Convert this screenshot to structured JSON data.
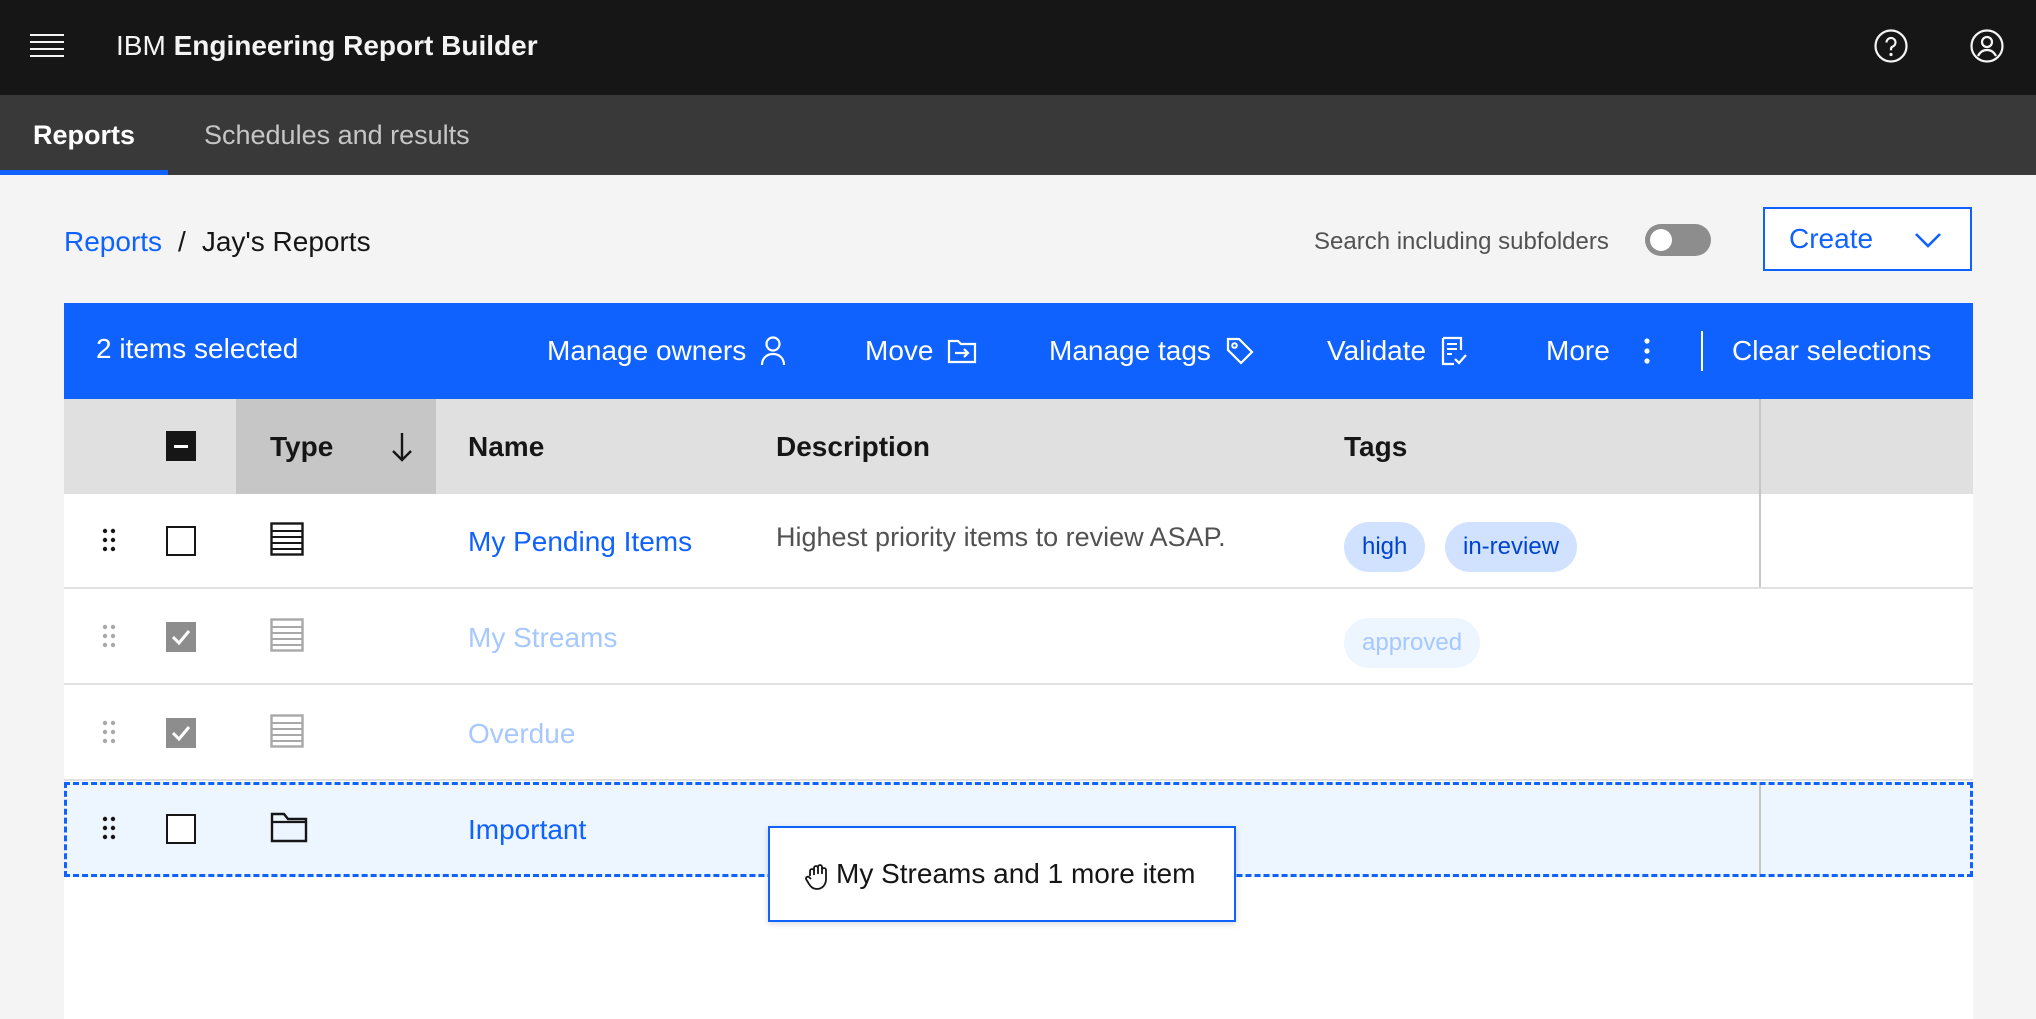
{
  "header": {
    "brand": "IBM",
    "product": "Engineering Report Builder",
    "icons": [
      "menu-icon",
      "help-icon",
      "user-avatar-icon"
    ]
  },
  "tabs": [
    {
      "label": "Reports",
      "active": true
    },
    {
      "label": "Schedules and results",
      "active": false
    }
  ],
  "breadcrumb": {
    "root": "Reports",
    "separator": "/",
    "current": "Jay's Reports"
  },
  "search_subfolders": {
    "label": "Search including subfolders",
    "on": false
  },
  "create_button": {
    "label": "Create"
  },
  "batch_actions": {
    "selected_count": "2 items selected",
    "manage_owners": "Manage owners",
    "move": "Move",
    "manage_tags": "Manage tags",
    "validate": "Validate",
    "more": "More",
    "clear": "Clear selections"
  },
  "table": {
    "columns": {
      "type": "Type",
      "name": "Name",
      "description": "Description",
      "tags": "Tags"
    },
    "sort": {
      "column": "Type",
      "direction": "descending"
    },
    "rows": [
      {
        "type": "report",
        "name": "My Pending Items",
        "description": "Highest priority items to review ASAP.",
        "tags": [
          "high",
          "in-review"
        ],
        "checked": false
      },
      {
        "type": "report",
        "name": "My Streams",
        "description": "",
        "tags": [
          "approved"
        ],
        "checked": true
      },
      {
        "type": "report",
        "name": "Overdue",
        "description": "",
        "tags": [],
        "checked": true
      },
      {
        "type": "folder",
        "name": "Important",
        "description": "",
        "tags": [],
        "checked": false
      }
    ]
  },
  "drag_preview": {
    "label": "My Streams and 1 more item"
  },
  "colors": {
    "accent": "#0f62fe",
    "header_bg": "#161616",
    "tabbar_bg": "#393939",
    "tag_bg": "#d0e2ff"
  }
}
